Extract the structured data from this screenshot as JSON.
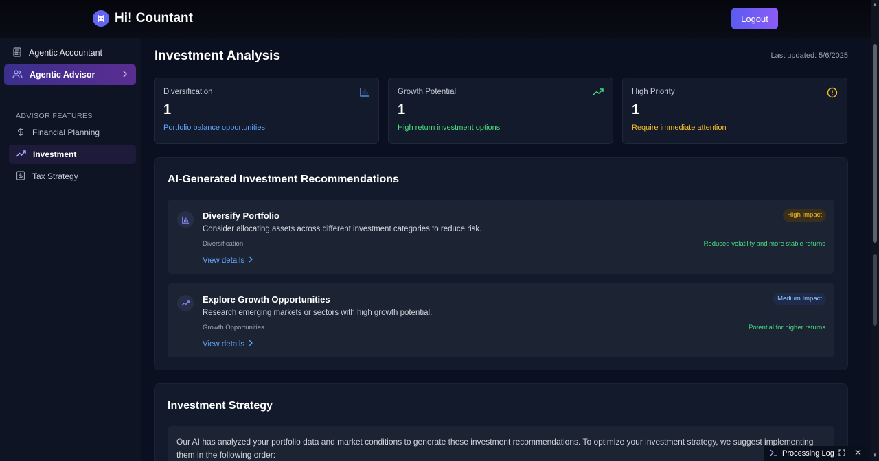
{
  "app": {
    "title": "Hi! Countant",
    "logout_label": "Logout"
  },
  "sidebar": {
    "top_items": [
      {
        "label": "Agentic Accountant",
        "icon": "calculator-icon"
      },
      {
        "label": "Agentic Advisor",
        "icon": "users-icon"
      }
    ],
    "section_label": "ADVISOR FEATURES",
    "sub_items": [
      {
        "label": "Financial Planning",
        "icon": "dollar-icon"
      },
      {
        "label": "Investment",
        "icon": "trending-up-icon"
      },
      {
        "label": "Tax Strategy",
        "icon": "receipt-dollar-icon"
      }
    ]
  },
  "page": {
    "title": "Investment Analysis",
    "last_updated": "Last updated: 5/6/2025"
  },
  "stats": [
    {
      "label": "Diversification",
      "value": "1",
      "desc": "Portfolio balance opportunities",
      "color": "#60a5fa",
      "icon": "bar-chart-icon"
    },
    {
      "label": "Growth Potential",
      "value": "1",
      "desc": "High return investment options",
      "color": "#4ade80",
      "icon": "trending-up-icon"
    },
    {
      "label": "High Priority",
      "value": "1",
      "desc": "Require immediate attention",
      "color": "#fbbf24",
      "icon": "alert-circle-icon"
    }
  ],
  "recommendations": {
    "title": "AI-Generated Investment Recommendations",
    "items": [
      {
        "title": "Diversify Portfolio",
        "desc": "Consider allocating assets across different investment categories to reduce risk.",
        "category": "Diversification",
        "link": "View details",
        "badge": "High Impact",
        "outcome": "Reduced volatility and more stable returns",
        "icon": "bar-chart-icon"
      },
      {
        "title": "Explore Growth Opportunities",
        "desc": "Research emerging markets or sectors with high growth potential.",
        "category": "Growth Opportunities",
        "link": "View details",
        "badge": "Medium Impact",
        "outcome": "Potential for higher returns",
        "icon": "trending-up-icon"
      }
    ]
  },
  "strategy": {
    "title": "Investment Strategy",
    "text": "Our AI has analyzed your portfolio data and market conditions to generate these investment recommendations. To optimize your investment strategy, we suggest implementing them in the following order:"
  },
  "processing_log": {
    "label": "Processing Log"
  },
  "colors": {
    "accent": "#6366f1",
    "badge_high_bg": "#3a2f1a",
    "badge_high_fg": "#fbbf24",
    "badge_medium_bg": "#1e2a4a",
    "badge_medium_fg": "#93c5fd"
  }
}
